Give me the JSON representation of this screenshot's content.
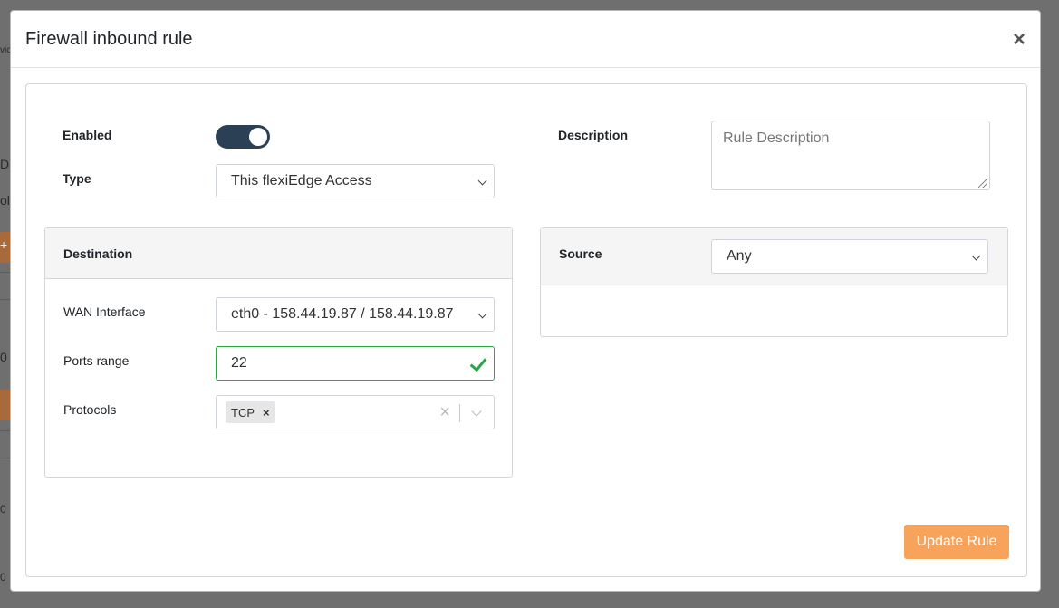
{
  "background": {
    "fragments": [
      "vic",
      "D",
      "ol",
      "+",
      "0",
      "0",
      "0"
    ]
  },
  "modal": {
    "title": "Firewall inbound rule",
    "close_label": "×"
  },
  "form": {
    "enabled_label": "Enabled",
    "enabled_value": true,
    "type_label": "Type",
    "type_value": "This flexiEdge Access",
    "description_label": "Description",
    "description_placeholder": "Rule Description"
  },
  "destination": {
    "title": "Destination",
    "wan_label": "WAN Interface",
    "wan_value": "eth0 - 158.44.19.87 / 158.44.19.87",
    "ports_label": "Ports range",
    "ports_value": "22",
    "protocols_label": "Protocols",
    "protocols_values": [
      "TCP"
    ],
    "chip_remove": "×",
    "clear_label": "×"
  },
  "source": {
    "title": "Source",
    "value": "Any"
  },
  "actions": {
    "update_label": "Update Rule"
  },
  "colors": {
    "toggle": "#2b3f55",
    "valid": "#28a745",
    "accent": "#f7a35c"
  }
}
